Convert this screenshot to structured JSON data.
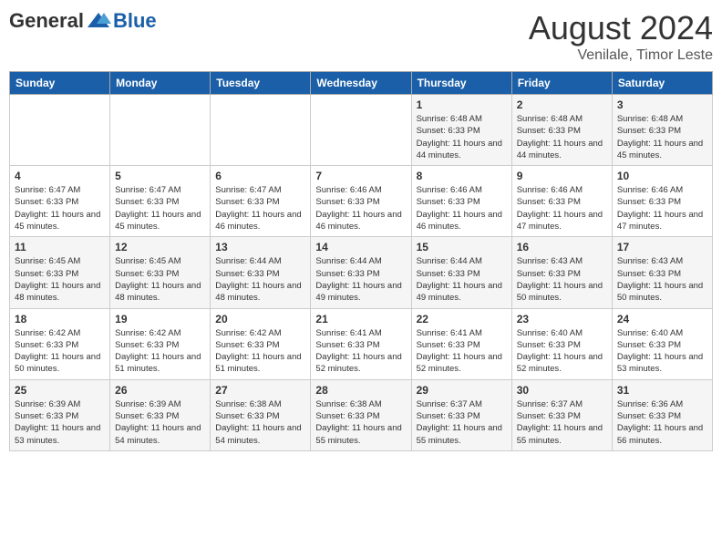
{
  "header": {
    "logo_general": "General",
    "logo_blue": "Blue",
    "month_year": "August 2024",
    "location": "Venilale, Timor Leste"
  },
  "days_of_week": [
    "Sunday",
    "Monday",
    "Tuesday",
    "Wednesday",
    "Thursday",
    "Friday",
    "Saturday"
  ],
  "weeks": [
    [
      {
        "day": "",
        "sunrise": "",
        "sunset": "",
        "daylight": ""
      },
      {
        "day": "",
        "sunrise": "",
        "sunset": "",
        "daylight": ""
      },
      {
        "day": "",
        "sunrise": "",
        "sunset": "",
        "daylight": ""
      },
      {
        "day": "",
        "sunrise": "",
        "sunset": "",
        "daylight": ""
      },
      {
        "day": "1",
        "sunrise": "Sunrise: 6:48 AM",
        "sunset": "Sunset: 6:33 PM",
        "daylight": "Daylight: 11 hours and 44 minutes."
      },
      {
        "day": "2",
        "sunrise": "Sunrise: 6:48 AM",
        "sunset": "Sunset: 6:33 PM",
        "daylight": "Daylight: 11 hours and 44 minutes."
      },
      {
        "day": "3",
        "sunrise": "Sunrise: 6:48 AM",
        "sunset": "Sunset: 6:33 PM",
        "daylight": "Daylight: 11 hours and 45 minutes."
      }
    ],
    [
      {
        "day": "4",
        "sunrise": "Sunrise: 6:47 AM",
        "sunset": "Sunset: 6:33 PM",
        "daylight": "Daylight: 11 hours and 45 minutes."
      },
      {
        "day": "5",
        "sunrise": "Sunrise: 6:47 AM",
        "sunset": "Sunset: 6:33 PM",
        "daylight": "Daylight: 11 hours and 45 minutes."
      },
      {
        "day": "6",
        "sunrise": "Sunrise: 6:47 AM",
        "sunset": "Sunset: 6:33 PM",
        "daylight": "Daylight: 11 hours and 46 minutes."
      },
      {
        "day": "7",
        "sunrise": "Sunrise: 6:46 AM",
        "sunset": "Sunset: 6:33 PM",
        "daylight": "Daylight: 11 hours and 46 minutes."
      },
      {
        "day": "8",
        "sunrise": "Sunrise: 6:46 AM",
        "sunset": "Sunset: 6:33 PM",
        "daylight": "Daylight: 11 hours and 46 minutes."
      },
      {
        "day": "9",
        "sunrise": "Sunrise: 6:46 AM",
        "sunset": "Sunset: 6:33 PM",
        "daylight": "Daylight: 11 hours and 47 minutes."
      },
      {
        "day": "10",
        "sunrise": "Sunrise: 6:46 AM",
        "sunset": "Sunset: 6:33 PM",
        "daylight": "Daylight: 11 hours and 47 minutes."
      }
    ],
    [
      {
        "day": "11",
        "sunrise": "Sunrise: 6:45 AM",
        "sunset": "Sunset: 6:33 PM",
        "daylight": "Daylight: 11 hours and 48 minutes."
      },
      {
        "day": "12",
        "sunrise": "Sunrise: 6:45 AM",
        "sunset": "Sunset: 6:33 PM",
        "daylight": "Daylight: 11 hours and 48 minutes."
      },
      {
        "day": "13",
        "sunrise": "Sunrise: 6:44 AM",
        "sunset": "Sunset: 6:33 PM",
        "daylight": "Daylight: 11 hours and 48 minutes."
      },
      {
        "day": "14",
        "sunrise": "Sunrise: 6:44 AM",
        "sunset": "Sunset: 6:33 PM",
        "daylight": "Daylight: 11 hours and 49 minutes."
      },
      {
        "day": "15",
        "sunrise": "Sunrise: 6:44 AM",
        "sunset": "Sunset: 6:33 PM",
        "daylight": "Daylight: 11 hours and 49 minutes."
      },
      {
        "day": "16",
        "sunrise": "Sunrise: 6:43 AM",
        "sunset": "Sunset: 6:33 PM",
        "daylight": "Daylight: 11 hours and 50 minutes."
      },
      {
        "day": "17",
        "sunrise": "Sunrise: 6:43 AM",
        "sunset": "Sunset: 6:33 PM",
        "daylight": "Daylight: 11 hours and 50 minutes."
      }
    ],
    [
      {
        "day": "18",
        "sunrise": "Sunrise: 6:42 AM",
        "sunset": "Sunset: 6:33 PM",
        "daylight": "Daylight: 11 hours and 50 minutes."
      },
      {
        "day": "19",
        "sunrise": "Sunrise: 6:42 AM",
        "sunset": "Sunset: 6:33 PM",
        "daylight": "Daylight: 11 hours and 51 minutes."
      },
      {
        "day": "20",
        "sunrise": "Sunrise: 6:42 AM",
        "sunset": "Sunset: 6:33 PM",
        "daylight": "Daylight: 11 hours and 51 minutes."
      },
      {
        "day": "21",
        "sunrise": "Sunrise: 6:41 AM",
        "sunset": "Sunset: 6:33 PM",
        "daylight": "Daylight: 11 hours and 52 minutes."
      },
      {
        "day": "22",
        "sunrise": "Sunrise: 6:41 AM",
        "sunset": "Sunset: 6:33 PM",
        "daylight": "Daylight: 11 hours and 52 minutes."
      },
      {
        "day": "23",
        "sunrise": "Sunrise: 6:40 AM",
        "sunset": "Sunset: 6:33 PM",
        "daylight": "Daylight: 11 hours and 52 minutes."
      },
      {
        "day": "24",
        "sunrise": "Sunrise: 6:40 AM",
        "sunset": "Sunset: 6:33 PM",
        "daylight": "Daylight: 11 hours and 53 minutes."
      }
    ],
    [
      {
        "day": "25",
        "sunrise": "Sunrise: 6:39 AM",
        "sunset": "Sunset: 6:33 PM",
        "daylight": "Daylight: 11 hours and 53 minutes."
      },
      {
        "day": "26",
        "sunrise": "Sunrise: 6:39 AM",
        "sunset": "Sunset: 6:33 PM",
        "daylight": "Daylight: 11 hours and 54 minutes."
      },
      {
        "day": "27",
        "sunrise": "Sunrise: 6:38 AM",
        "sunset": "Sunset: 6:33 PM",
        "daylight": "Daylight: 11 hours and 54 minutes."
      },
      {
        "day": "28",
        "sunrise": "Sunrise: 6:38 AM",
        "sunset": "Sunset: 6:33 PM",
        "daylight": "Daylight: 11 hours and 55 minutes."
      },
      {
        "day": "29",
        "sunrise": "Sunrise: 6:37 AM",
        "sunset": "Sunset: 6:33 PM",
        "daylight": "Daylight: 11 hours and 55 minutes."
      },
      {
        "day": "30",
        "sunrise": "Sunrise: 6:37 AM",
        "sunset": "Sunset: 6:33 PM",
        "daylight": "Daylight: 11 hours and 55 minutes."
      },
      {
        "day": "31",
        "sunrise": "Sunrise: 6:36 AM",
        "sunset": "Sunset: 6:33 PM",
        "daylight": "Daylight: 11 hours and 56 minutes."
      }
    ]
  ]
}
